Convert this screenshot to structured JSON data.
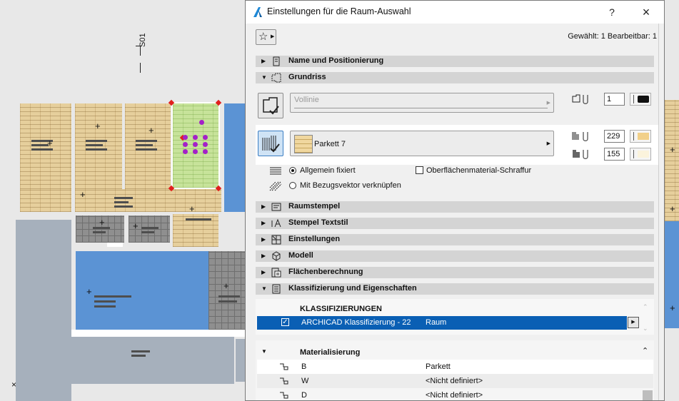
{
  "plan": {
    "section_label": "S01"
  },
  "dialog": {
    "title": "Einstellungen für die Raum-Auswahl",
    "help_label": "?",
    "close_label": "×",
    "selection_info": "Gewählt: 1 Bearbeitbar: 1",
    "sections": {
      "name": "Name und Positionierung",
      "grundriss": "Grundriss",
      "raumstempel": "Raumstempel",
      "stempel_textstil": "Stempel Textstil",
      "einstellungen": "Einstellungen",
      "modell": "Modell",
      "flaechen": "Flächenberechnung",
      "klassifizierung": "Klassifizierung und Eigenschaften"
    },
    "grundriss": {
      "line_type": "Vollinie",
      "pen_value": "1",
      "fill_name": "Parkett 7",
      "fg_pen": "229",
      "bg_pen": "155",
      "radio_fixed": "Allgemein fixiert",
      "radio_vector": "Mit Bezugsvektor verknüpfen",
      "surface_hatch": "Oberflächenmaterial-Schraffur"
    },
    "classification": {
      "header": "KLASSIFIZIERUNGEN",
      "row_name": "ARCHICAD Klassifizierung - 22",
      "row_value": "Raum"
    },
    "materialization": {
      "header": "Materialisierung",
      "rows": [
        {
          "key": "B",
          "value": "Parkett"
        },
        {
          "key": "W",
          "value": "<Nicht definiert>"
        },
        {
          "key": "D",
          "value": "<Nicht definiert>"
        }
      ]
    },
    "colors": {
      "selected_row": "#0a5fb4",
      "section_bg": "#d4d4d4",
      "highlight_panel": "#ffffff"
    }
  }
}
